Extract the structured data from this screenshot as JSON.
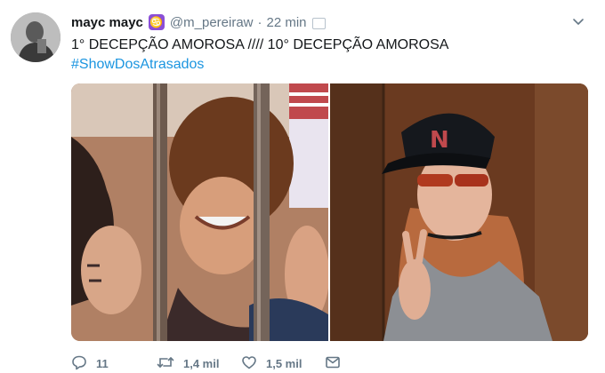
{
  "author": {
    "display_name": "mayc mayc",
    "zodiac_glyph": "♋",
    "handle": "@m_pereiraw",
    "separator": "·",
    "timestamp": "22 min"
  },
  "tweet": {
    "text": "1° DECEPÇÃO AMOROSA //// 10° DECEPÇÃO AMOROSA",
    "hashtag": "#ShowDosAtrasados"
  },
  "actions": {
    "replies": "11",
    "retweets": "1,4 mil",
    "likes": "1,5 mil"
  },
  "colors": {
    "link": "#1b95e0",
    "muted": "#657786",
    "text": "#14171a",
    "zodiac_badge": "#8a4fd6"
  },
  "icons": [
    "chevron-down-icon",
    "reply-icon",
    "retweet-icon",
    "like-icon",
    "message-icon"
  ]
}
